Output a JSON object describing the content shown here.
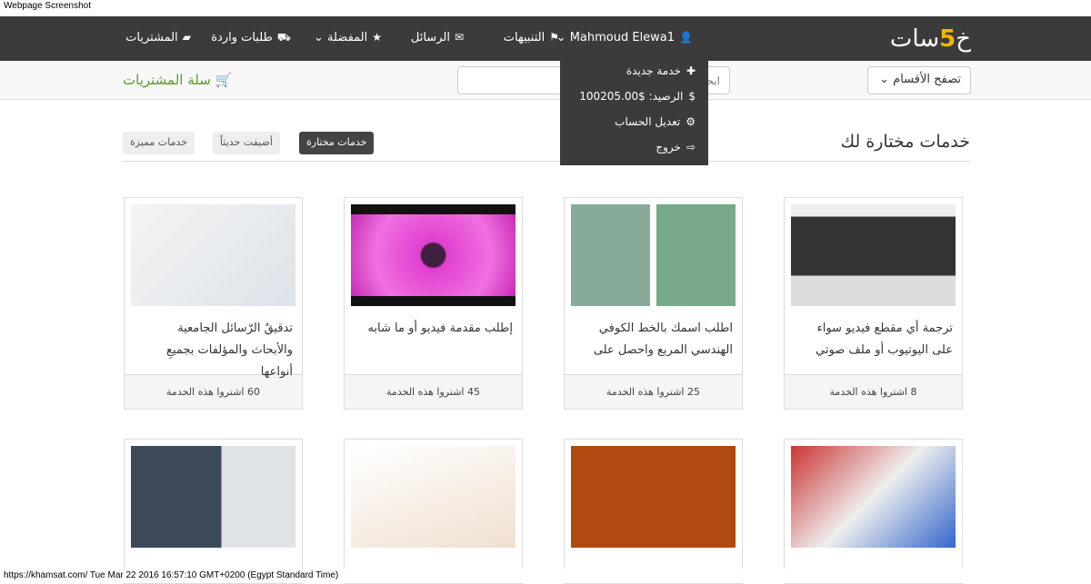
{
  "caption": "Webpage Screenshot",
  "logo": {
    "pre": "خ",
    "five": "5",
    "post": "سات"
  },
  "nav": {
    "user": "Mahmoud Elewa1",
    "notifications": "التنبيهات",
    "messages": "الرسائل",
    "favorites": "المفضلة",
    "incoming": "طلبات واردة",
    "purchases": "المشتريات"
  },
  "user_menu": [
    {
      "icon": "plus",
      "label": "خدمة جديدة"
    },
    {
      "icon": "dollar",
      "label": "الرصيد: $100205.00"
    },
    {
      "icon": "gear",
      "label": "تعديل الحساب"
    },
    {
      "icon": "sign-out",
      "label": "خروج"
    }
  ],
  "subbar": {
    "browse": "تصفح الأقسام",
    "search_placeholder": "ابحث عن خدمة",
    "cart": "سلة المشتريات"
  },
  "section": {
    "title": "خدمات مختارة لك",
    "tabs": [
      "خدمات مختارة",
      "أضيفت حديثاً",
      "خدمات مميزة"
    ]
  },
  "cards": [
    {
      "title": "ترجمة أي مقطع فيديو سواء على اليوتيوب أو ملف صوتي",
      "footer": "8 اشتروا هذه الخدمة"
    },
    {
      "title": "اطلب اسمك بالخط الكوفي الهندسي المربع واحصل على",
      "footer": "25 اشتروا هذه الخدمة"
    },
    {
      "title": "إطلب مقدمة فيديو أو ما شابه",
      "footer": "45 اشتروا هذه الخدمة"
    },
    {
      "title": "تدقيقُ الرّسائل الجامعية والأبحاث والمؤلفات بجميعِ أنواعها",
      "footer": "60 اشتروا هذه الخدمة"
    }
  ],
  "status": "https://khamsat.com/ Tue Mar 22 2016 16:57:10 GMT+0200 (Egypt Standard Time)"
}
